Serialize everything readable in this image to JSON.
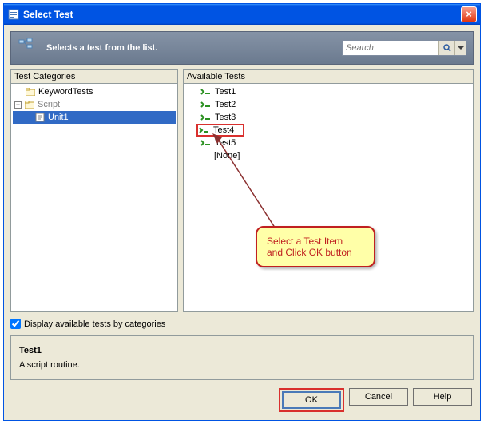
{
  "titlebar": {
    "title": "Select Test"
  },
  "header": {
    "text": "Selects a test from the list."
  },
  "search": {
    "placeholder": "Search"
  },
  "leftPanel": {
    "label": "Test Categories"
  },
  "tree": {
    "keywordTests": "KeywordTests",
    "script": "Script",
    "unit1": "Unit1"
  },
  "rightPanel": {
    "label": "Available Tests"
  },
  "tests": {
    "t1": "Test1",
    "t2": "Test2",
    "t3": "Test3",
    "t4": "Test4",
    "t5": "Test5",
    "none": "[None]"
  },
  "callout": {
    "line1": "Select a Test Item",
    "line2": "and Click OK button"
  },
  "checkbox": {
    "label": "Display available tests by categories"
  },
  "info": {
    "title": "Test1",
    "desc": "A script routine."
  },
  "buttons": {
    "ok": "OK",
    "cancel": "Cancel",
    "help": "Help"
  }
}
